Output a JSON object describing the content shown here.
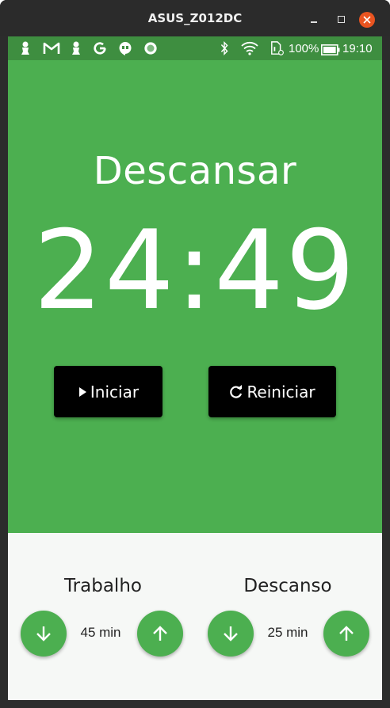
{
  "window": {
    "title": "ASUS_Z012DC"
  },
  "statusbar": {
    "battery": "100%",
    "time": "19:10"
  },
  "timer": {
    "mode": "Descansar",
    "time": "24:49",
    "start_label": "Iniciar",
    "reset_label": "Reiniciar"
  },
  "settings": {
    "work": {
      "label": "Trabalho",
      "value": "45 min"
    },
    "break": {
      "label": "Descanso",
      "value": "25 min"
    }
  },
  "colors": {
    "primary": "#4caf50",
    "statusbar": "#3e8e40",
    "button": "#000000",
    "settings_bg": "#f6f8f6",
    "close": "#e95420"
  },
  "icons": [
    "play-icon",
    "refresh-icon",
    "arrow-down-icon",
    "arrow-up-icon",
    "bluetooth-icon",
    "wifi-icon",
    "battery-icon"
  ]
}
